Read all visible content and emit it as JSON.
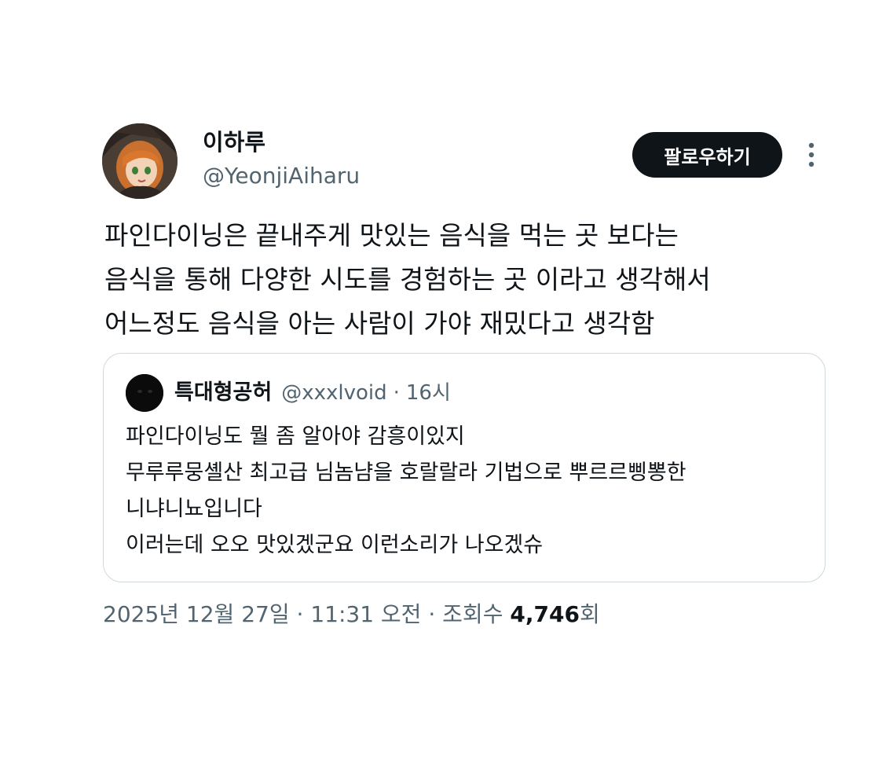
{
  "author": {
    "display_name": "이하루",
    "handle": "@YeonjiAiharu"
  },
  "follow_button": {
    "label": "팔로우하기"
  },
  "tweet": {
    "lines": [
      "파인다이닝은 끝내주게 맛있는 음식을 먹는 곳 보다는",
      "음식을 통해 다양한 시도를 경험하는 곳 이라고 생각해서",
      "어느정도 음식을 아는 사람이 가야 재밌다고 생각함"
    ]
  },
  "quote": {
    "display_name": "특대형공허",
    "handle": "@xxxlvoid",
    "separator": "·",
    "time": "16시",
    "lines": [
      "파인다이닝도 뭘 좀 알아야 감흥이있지",
      "무루루뭉셸산 최고급 님놈냠을 호랄랄라 기법으로 뿌르르삥뽕한",
      "니냐니뇨입니다",
      "이러는데 오오 맛있겠군요 이런소리가 나오겠슈"
    ]
  },
  "meta": {
    "date": "2025년 12월 27일",
    "separator": "·",
    "time": "11:31 오전",
    "views_label": "조회수",
    "views_count": "4,746",
    "views_suffix": "회"
  },
  "icons": {
    "more": "more-vertical-icon"
  },
  "colors": {
    "text_primary": "#0f1419",
    "text_secondary": "#536471",
    "button_bg": "#0f1419",
    "border": "#cfd9de"
  }
}
